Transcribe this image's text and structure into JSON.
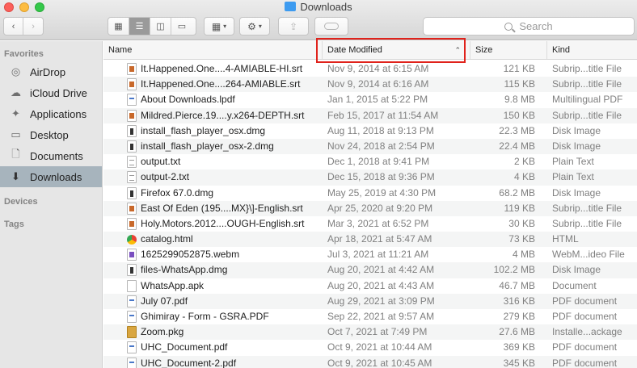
{
  "window": {
    "title": "Downloads"
  },
  "toolbar": {
    "back_icon": "chevron-left",
    "forward_icon": "chevron-right",
    "view_modes": [
      "icon-view",
      "list-view",
      "column-view",
      "gallery-view"
    ],
    "active_view": "list-view",
    "search_placeholder": "Search"
  },
  "sidebar": {
    "favorites_header": "Favorites",
    "items": [
      {
        "label": "AirDrop",
        "icon": "airdrop-icon"
      },
      {
        "label": "iCloud Drive",
        "icon": "cloud-icon"
      },
      {
        "label": "Applications",
        "icon": "applications-icon"
      },
      {
        "label": "Desktop",
        "icon": "desktop-icon"
      },
      {
        "label": "Documents",
        "icon": "documents-icon"
      },
      {
        "label": "Downloads",
        "icon": "downloads-icon",
        "selected": true
      }
    ],
    "devices_header": "Devices",
    "tags_header": "Tags"
  },
  "columns": {
    "name": "Name",
    "date": "Date Modified",
    "size": "Size",
    "kind": "Kind",
    "sorted_by": "Date Modified",
    "sort_direction": "ascending"
  },
  "files": [
    {
      "name": "It.Happened.One....4-AMIABLE-HI.srt",
      "date": "Nov 9, 2014 at 6:15 AM",
      "size": "121 KB",
      "kind": "Subrip...title File",
      "icon": "srt"
    },
    {
      "name": "It.Happened.One....264-AMIABLE.srt",
      "date": "Nov 9, 2014 at 6:16 AM",
      "size": "115 KB",
      "kind": "Subrip...title File",
      "icon": "srt"
    },
    {
      "name": "About Downloads.lpdf",
      "date": "Jan 1, 2015 at 5:22 PM",
      "size": "9.8 MB",
      "kind": "Multilingual PDF",
      "icon": "pdf"
    },
    {
      "name": "Mildred.Pierce.19....y.x264-DEPTH.srt",
      "date": "Feb 15, 2017 at 11:54 AM",
      "size": "150 KB",
      "kind": "Subrip...title File",
      "icon": "srt"
    },
    {
      "name": "install_flash_player_osx.dmg",
      "date": "Aug 11, 2018 at 9:13 PM",
      "size": "22.3 MB",
      "kind": "Disk Image",
      "icon": "dmg"
    },
    {
      "name": "install_flash_player_osx-2.dmg",
      "date": "Nov 24, 2018 at 2:54 PM",
      "size": "22.4 MB",
      "kind": "Disk Image",
      "icon": "dmg"
    },
    {
      "name": "output.txt",
      "date": "Dec 1, 2018 at 9:41 PM",
      "size": "2 KB",
      "kind": "Plain Text",
      "icon": "txt"
    },
    {
      "name": "output-2.txt",
      "date": "Dec 15, 2018 at 9:36 PM",
      "size": "4 KB",
      "kind": "Plain Text",
      "icon": "txt"
    },
    {
      "name": "Firefox 67.0.dmg",
      "date": "May 25, 2019 at 4:30 PM",
      "size": "68.2 MB",
      "kind": "Disk Image",
      "icon": "dmg"
    },
    {
      "name": "East Of Eden (195....MX}\\]-English.srt",
      "date": "Apr 25, 2020 at 9:20 PM",
      "size": "119 KB",
      "kind": "Subrip...title File",
      "icon": "srt"
    },
    {
      "name": "Holy.Motors.2012....OUGH-English.srt",
      "date": "Mar 3, 2021 at 6:52 PM",
      "size": "30 KB",
      "kind": "Subrip...title File",
      "icon": "srt"
    },
    {
      "name": "catalog.html",
      "date": "Apr 18, 2021 at 5:47 AM",
      "size": "73 KB",
      "kind": "HTML",
      "icon": "web"
    },
    {
      "name": "1625299052875.webm",
      "date": "Jul 3, 2021 at 11:21 AM",
      "size": "4 MB",
      "kind": "WebM...ideo File",
      "icon": "webm"
    },
    {
      "name": "files-WhatsApp.dmg",
      "date": "Aug 20, 2021 at 4:42 AM",
      "size": "102.2 MB",
      "kind": "Disk Image",
      "icon": "dmg"
    },
    {
      "name": "WhatsApp.apk",
      "date": "Aug 20, 2021 at 4:43 AM",
      "size": "46.7 MB",
      "kind": "Document",
      "icon": "doc"
    },
    {
      "name": "July 07.pdf",
      "date": "Aug 29, 2021 at 3:09 PM",
      "size": "316 KB",
      "kind": "PDF document",
      "icon": "pdf"
    },
    {
      "name": "Ghimiray - Form - GSRA.PDF",
      "date": "Sep 22, 2021 at 9:57 AM",
      "size": "279 KB",
      "kind": "PDF document",
      "icon": "pdf"
    },
    {
      "name": "Zoom.pkg",
      "date": "Oct 7, 2021 at 7:49 PM",
      "size": "27.6 MB",
      "kind": "Installe...ackage",
      "icon": "pkg"
    },
    {
      "name": "UHC_Document.pdf",
      "date": "Oct 9, 2021 at 10:44 AM",
      "size": "369 KB",
      "kind": "PDF document",
      "icon": "pdf"
    },
    {
      "name": "UHC_Document-2.pdf",
      "date": "Oct 9, 2021 at 10:45 AM",
      "size": "345 KB",
      "kind": "PDF document",
      "icon": "pdf"
    }
  ]
}
